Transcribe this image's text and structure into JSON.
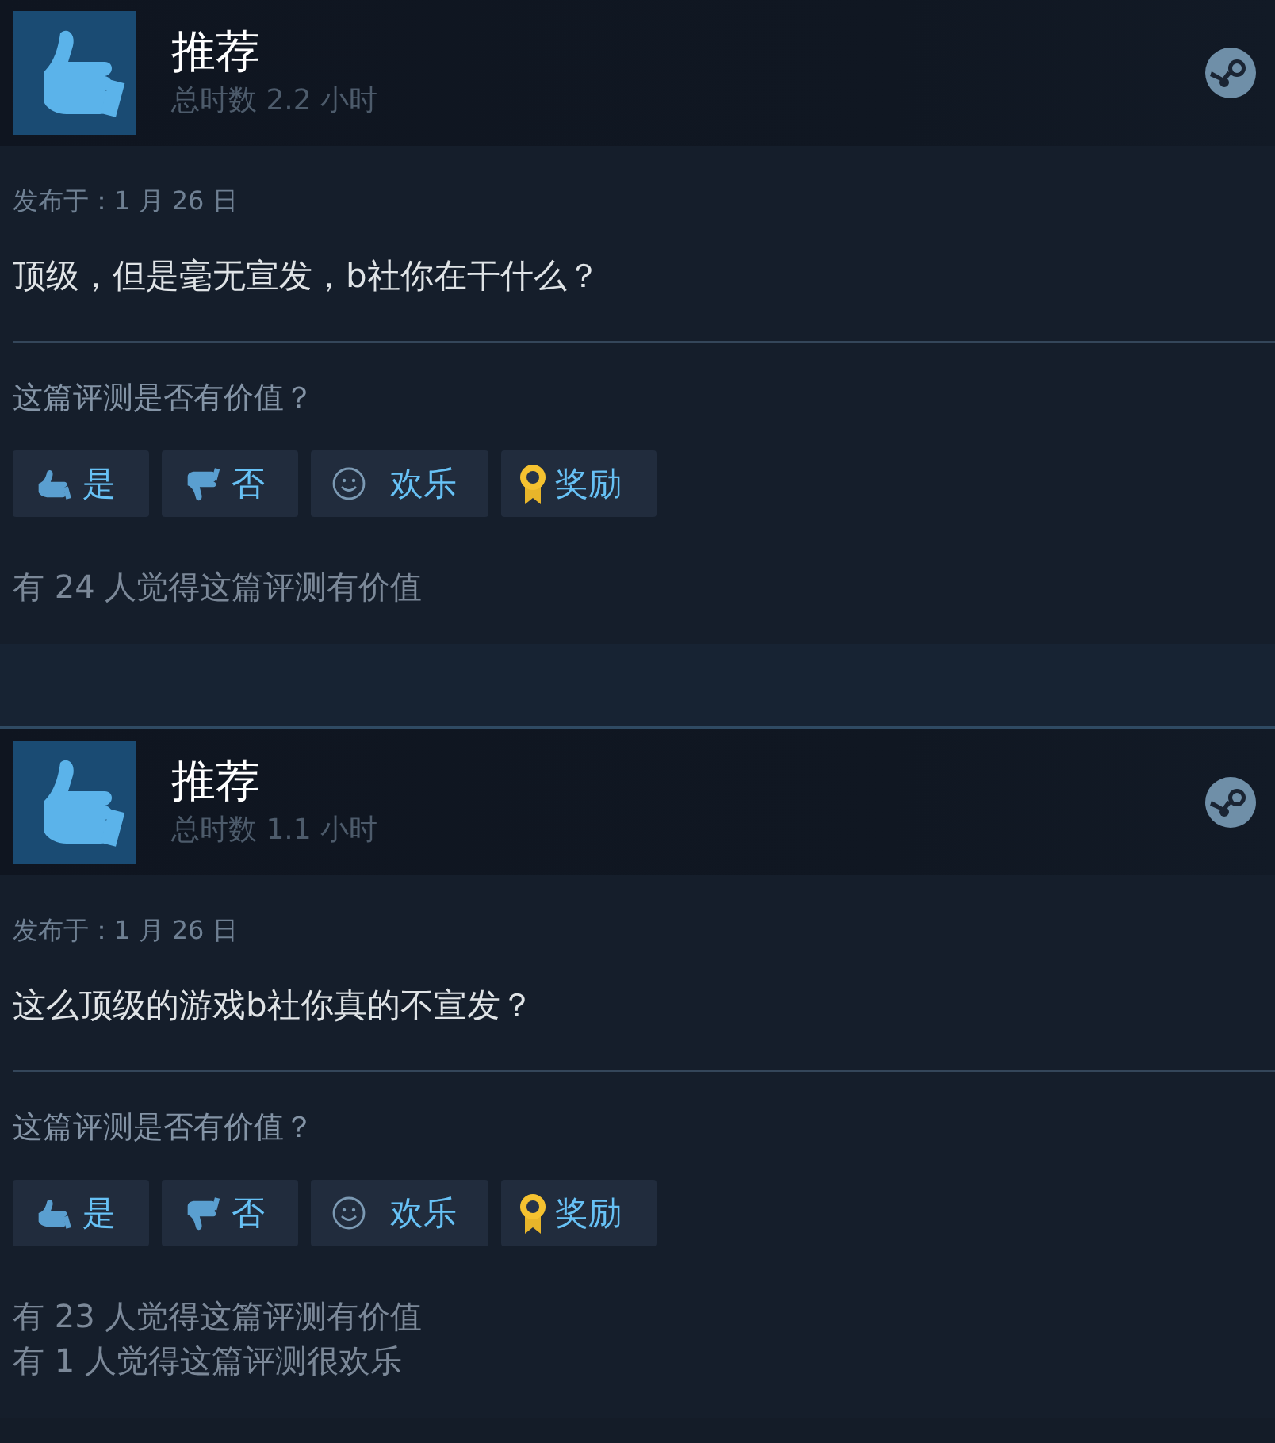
{
  "reviews": [
    {
      "verdict": "推荐",
      "recommended": true,
      "hours": "总时数 2.2 小时",
      "date": "发布于：1 月 26 日",
      "text": "顶级，但是毫无宣发，b社你在干什么？",
      "question": "这篇评测是否有价值？",
      "buttons": [
        {
          "kind": "yes",
          "label": "是"
        },
        {
          "kind": "no",
          "label": "否"
        },
        {
          "kind": "funny",
          "label": "欢乐"
        },
        {
          "kind": "award",
          "label": "奖励"
        }
      ],
      "counts": [
        "有 24 人觉得这篇评测有价值"
      ]
    },
    {
      "verdict": "推荐",
      "recommended": true,
      "hours": "总时数 1.1 小时",
      "date": "发布于：1 月 26 日",
      "text": "这么顶级的游戏b社你真的不宣发？",
      "question": "这篇评测是否有价值？",
      "buttons": [
        {
          "kind": "yes",
          "label": "是"
        },
        {
          "kind": "no",
          "label": "否"
        },
        {
          "kind": "funny",
          "label": "欢乐"
        },
        {
          "kind": "award",
          "label": "奖励"
        }
      ],
      "counts": [
        "有 23 人觉得这篇评测有价值",
        "有 1 人觉得这篇评测很欢乐"
      ]
    }
  ]
}
